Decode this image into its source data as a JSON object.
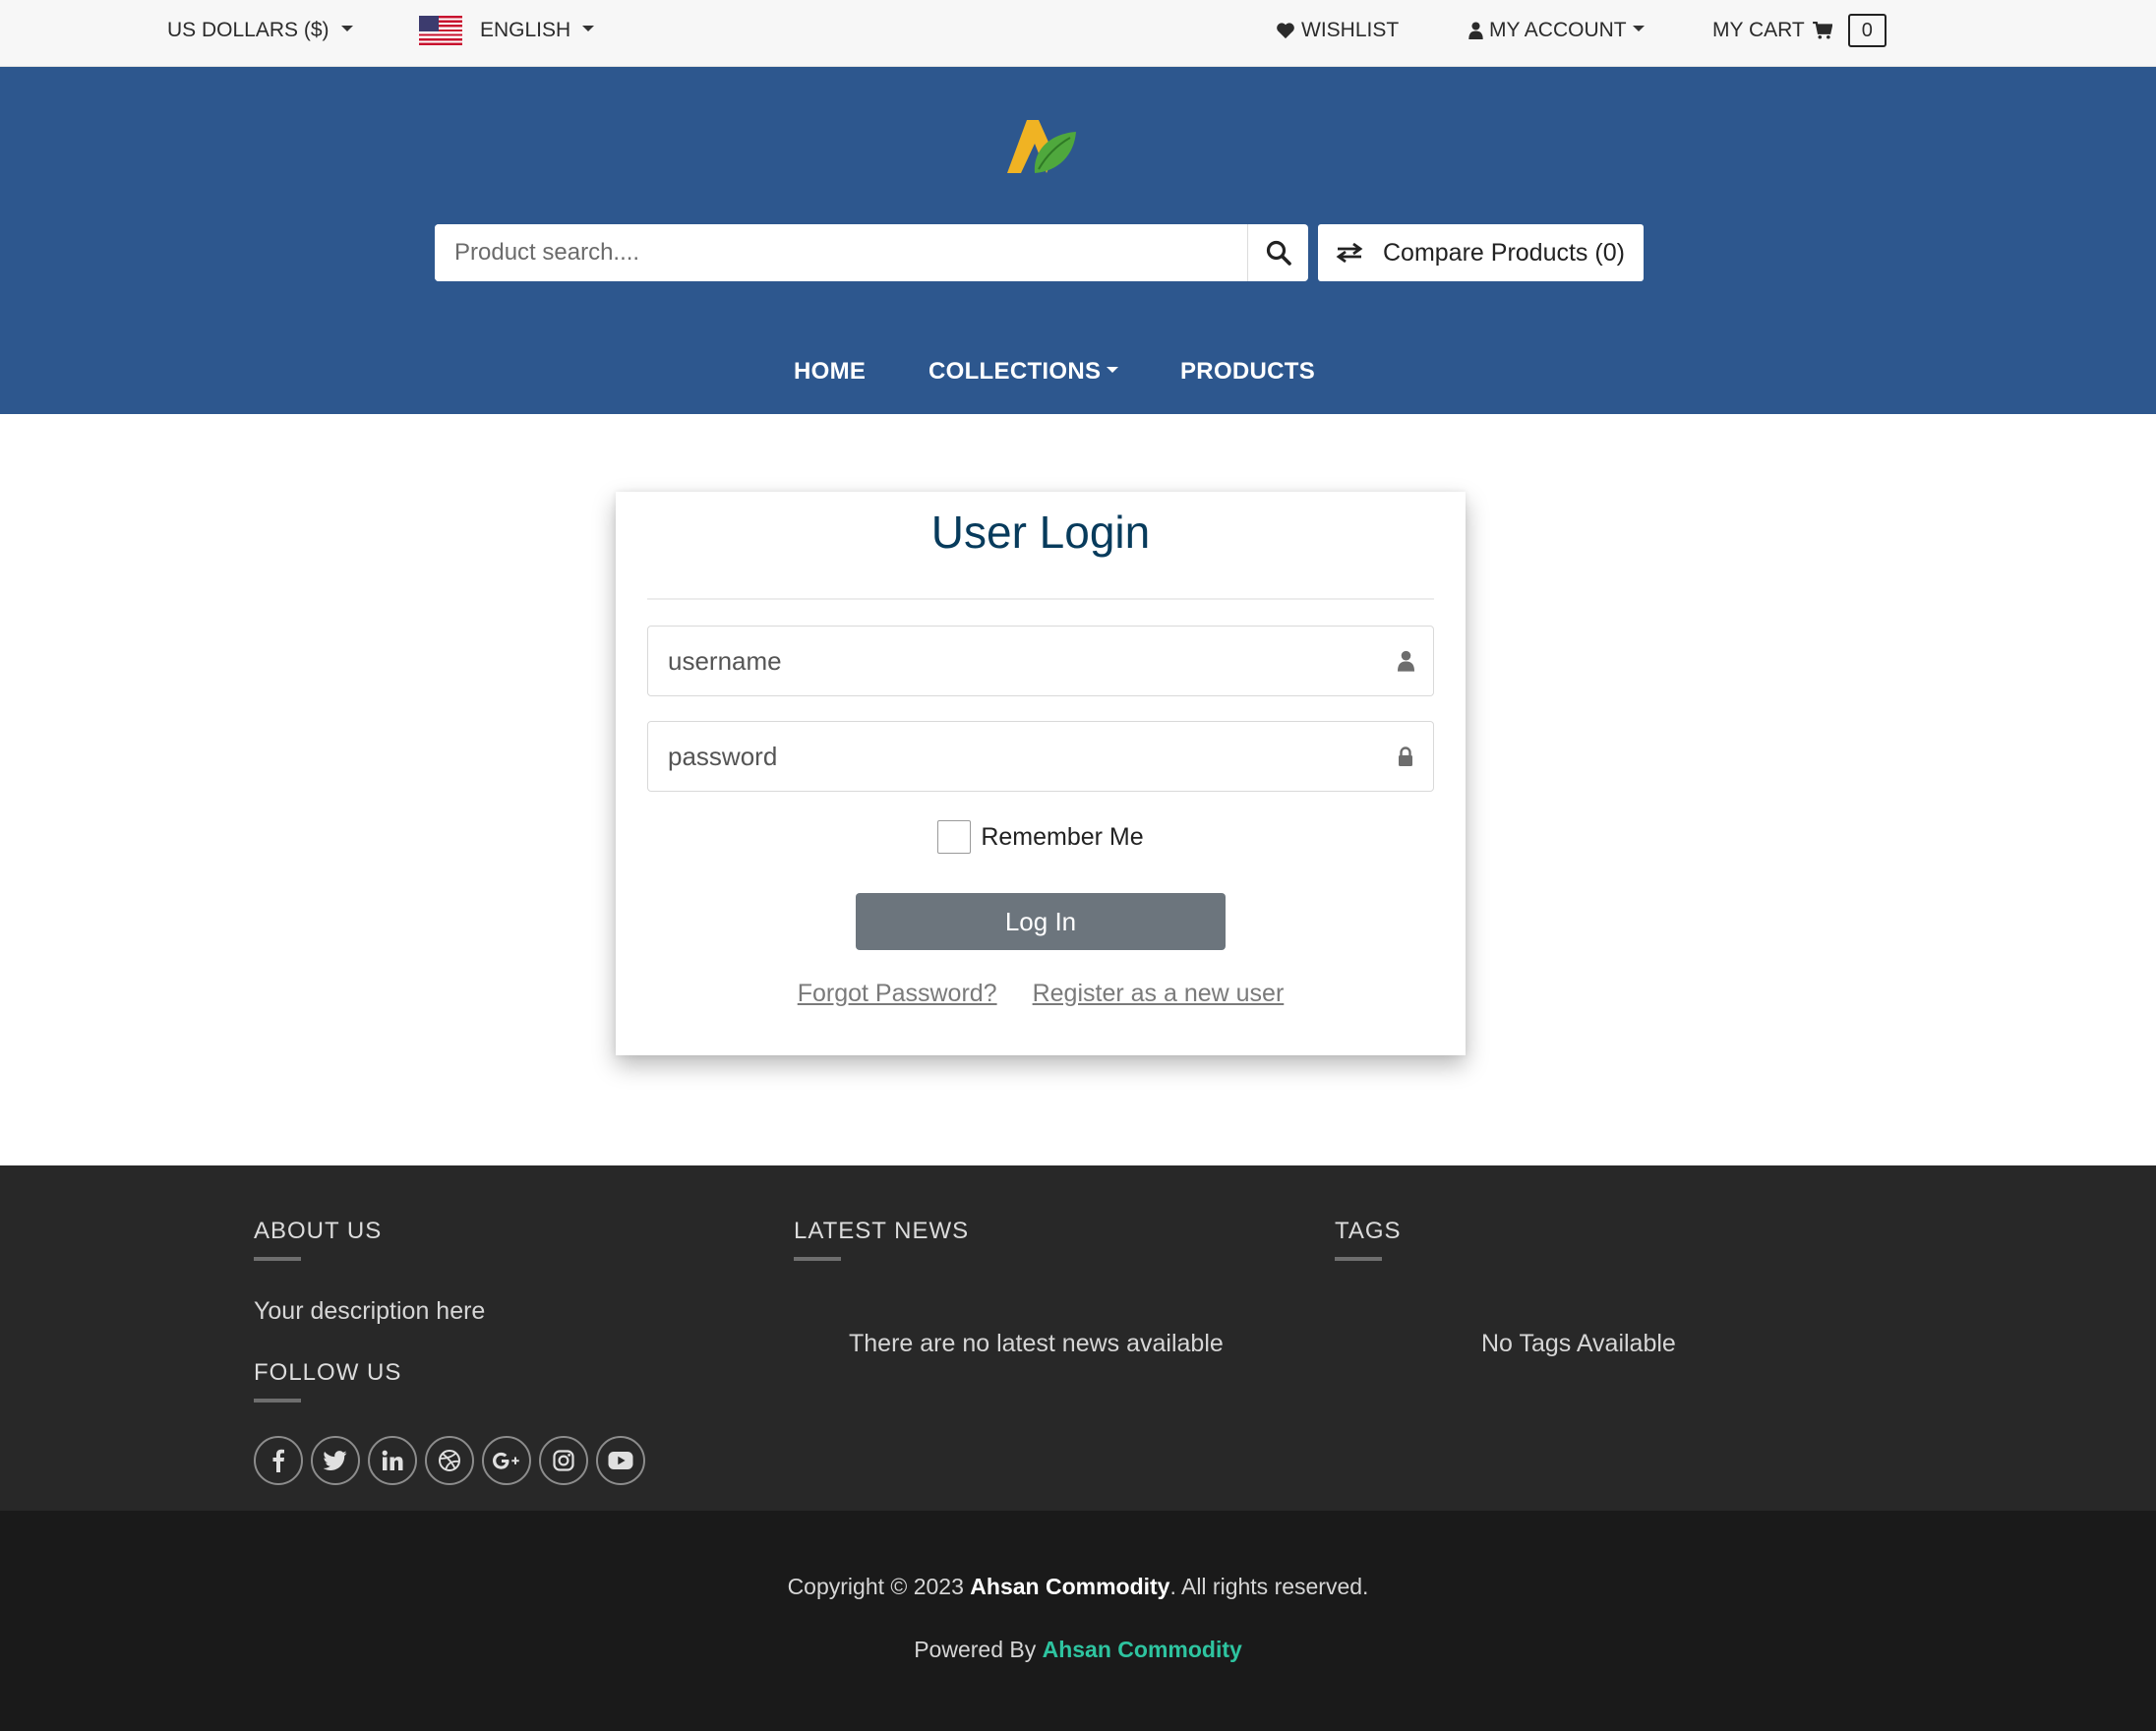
{
  "topbar": {
    "currency": "US DOLLARS ($)",
    "language": "ENGLISH",
    "wishlist": "WISHLIST",
    "account": "MY ACCOUNT",
    "cart": "MY CART",
    "cart_count": "0"
  },
  "header": {
    "search_placeholder": "Product search....",
    "compare": "Compare Products (0)",
    "nav": {
      "home": "HOME",
      "collections": "COLLECTIONS",
      "products": "PRODUCTS"
    }
  },
  "login": {
    "title": "User Login",
    "username_placeholder": "username",
    "password_placeholder": "password",
    "remember": "Remember Me",
    "button": "Log In",
    "forgot": "Forgot Password?",
    "register": "Register as a new user"
  },
  "footer": {
    "about_heading": "ABOUT US",
    "about_text": "Your description here",
    "follow_heading": "FOLLOW US",
    "news_heading": "LATEST NEWS",
    "news_text": "There are no latest news available",
    "tags_heading": "TAGS",
    "tags_text": "No Tags Available",
    "socials": [
      "facebook-icon",
      "twitter-icon",
      "linkedin-icon",
      "dribbble-icon",
      "google-plus-icon",
      "instagram-icon",
      "youtube-icon"
    ]
  },
  "bottom": {
    "copy_prefix": "Copyright © 2023 ",
    "copy_brand": "Ahsan Commodity",
    "copy_suffix": ". All rights reserved.",
    "powered_prefix": "Powered By ",
    "powered_brand": "Ahsan Commodity"
  },
  "colors": {
    "header_bg": "#2d578e",
    "title": "#073b5c",
    "login_button": "#6c757d",
    "footer_bg": "#282828",
    "bottom_bg": "#1a1a1a",
    "accent": "#2ec4a0"
  }
}
